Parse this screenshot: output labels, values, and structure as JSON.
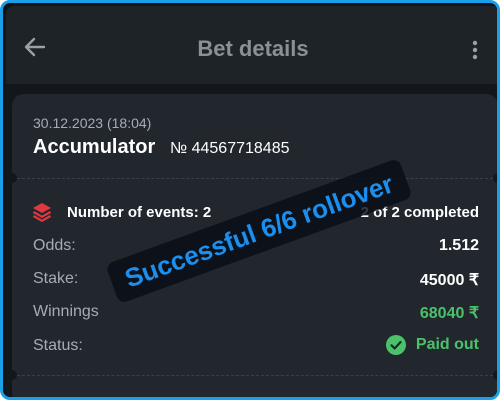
{
  "header": {
    "title": "Bet details",
    "back_icon": "arrow-left-icon",
    "menu_icon": "more-vertical-icon"
  },
  "bet": {
    "date": "30.12.2023 (18:04)",
    "type": "Accumulator",
    "number": "№ 44567718485",
    "events_icon": "layers-icon",
    "events_label": "Number of events: 2",
    "events_status": "2 of 2 completed",
    "rows": [
      {
        "label": "Odds:",
        "value": "1.512"
      },
      {
        "label": "Stake:",
        "value": "45000 ₹"
      },
      {
        "label": "Winnings",
        "value": "68040 ₹"
      },
      {
        "label": "Status:",
        "value": "Paid out"
      }
    ],
    "status_icon": "check-circle-icon"
  },
  "overlay": {
    "text": "Successful 6/6 rollover"
  },
  "colors": {
    "accent_red": "#e0383e",
    "success_green": "#4cc16b",
    "overlay_blue": "#1a8ff0",
    "frame_blue": "#1aa0e8"
  }
}
